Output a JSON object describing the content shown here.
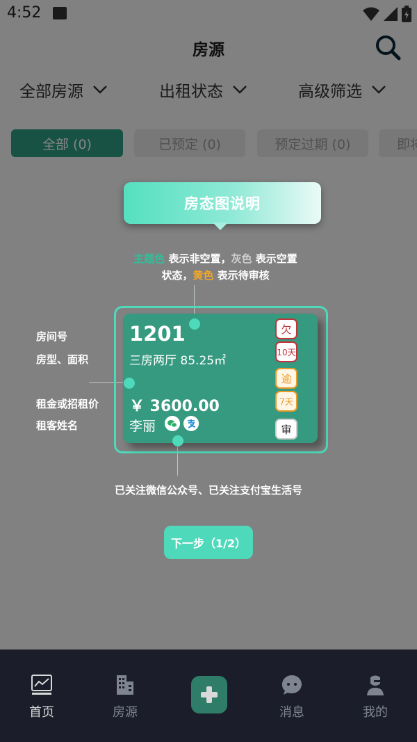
{
  "status_bar": {
    "time": "4:52"
  },
  "header": {
    "title": "房源"
  },
  "filters": [
    {
      "label": "全部房源"
    },
    {
      "label": "出租状态"
    },
    {
      "label": "高级筛选"
    }
  ],
  "tabs": [
    {
      "label": "全部 (0)",
      "active": true
    },
    {
      "label": "已预定 (0)"
    },
    {
      "label": "预定过期 (0)"
    },
    {
      "label": "即将"
    }
  ],
  "tutorial": {
    "title": "房态图说明",
    "legend_line1": {
      "theme": "主题色",
      "theme_desc": " 表示非空置，",
      "grey": "灰色",
      "grey_desc": " 表示空置"
    },
    "legend_line2": {
      "prefix": "状态，",
      "yellow": "黄色",
      "yellow_desc": " 表示待审核"
    },
    "side_labels": {
      "room_no": "房间号",
      "type_area": "房型、面积",
      "rent": "租金或招租价",
      "tenant": "租客姓名"
    },
    "follow_desc": "已关注微信公众号、已关注支付宝生活号",
    "next_button": "下一步（1/2）",
    "card": {
      "room_no": "1201",
      "room_type": "三房两厅 85.25㎡",
      "rent": "￥ 3600.00",
      "tenant": "李丽",
      "tags": {
        "owe": "欠",
        "owe_days": "10天",
        "overdue": "逾",
        "overdue_days": "7天",
        "review": "审"
      }
    },
    "colors": {
      "theme": "#2fbf9a",
      "grey": "#cfcfcf",
      "yellow": "#f1a52a"
    }
  },
  "bottom_nav": [
    {
      "label": "首页",
      "icon": "chart-icon",
      "active": true
    },
    {
      "label": "房源",
      "icon": "building-icon"
    },
    {
      "label": "",
      "icon": "add-icon"
    },
    {
      "label": "消息",
      "icon": "message-icon"
    },
    {
      "label": "我的",
      "icon": "user-icon"
    }
  ]
}
